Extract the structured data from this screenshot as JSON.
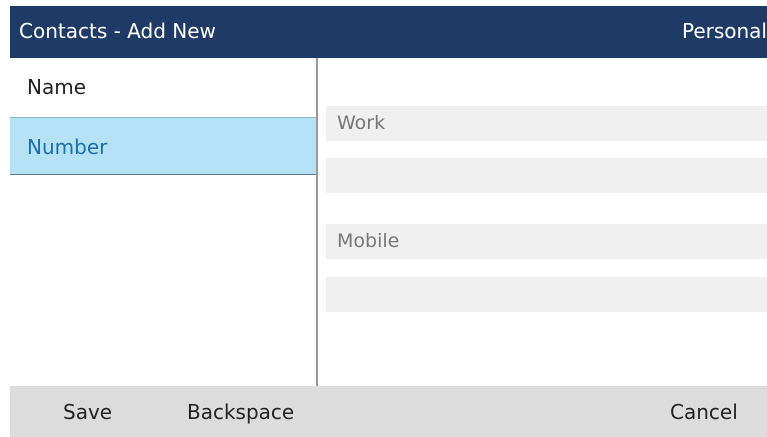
{
  "header": {
    "title": "Contacts - Add New",
    "contact_type": "Personal"
  },
  "menu": {
    "items": [
      {
        "label": "Name",
        "selected": false
      },
      {
        "label": "Number",
        "selected": true
      }
    ]
  },
  "fields": {
    "work": {
      "label": "Work",
      "value": ""
    },
    "mobile": {
      "label": "Mobile",
      "value": ""
    }
  },
  "softkeys": {
    "save": "Save",
    "backspace": "Backspace",
    "cancel": "Cancel"
  },
  "colors": {
    "header_bg": "#1e3a66",
    "selected_bg": "#b6e2f5",
    "selected_text": "#1a6fb0",
    "softkey_bar_bg": "#dcdcdc",
    "field_bg": "#f0f0f0"
  }
}
